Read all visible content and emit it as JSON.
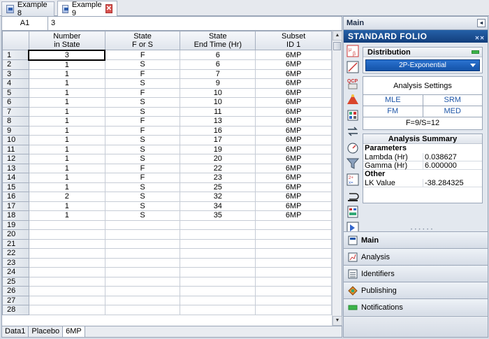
{
  "tabs": [
    {
      "label": "Example 8",
      "active": false
    },
    {
      "label": "Example 9",
      "active": true
    }
  ],
  "formula_bar": {
    "cell_ref": "A1",
    "value": "3"
  },
  "grid": {
    "headers": [
      {
        "line1": "Number",
        "line2": "in State"
      },
      {
        "line1": "State",
        "line2": "F or S"
      },
      {
        "line1": "State",
        "line2": "End Time (Hr)"
      },
      {
        "line1": "Subset",
        "line2": "ID 1"
      }
    ],
    "rows": [
      [
        "3",
        "F",
        "6",
        "6MP"
      ],
      [
        "1",
        "S",
        "6",
        "6MP"
      ],
      [
        "1",
        "F",
        "7",
        "6MP"
      ],
      [
        "1",
        "S",
        "9",
        "6MP"
      ],
      [
        "1",
        "F",
        "10",
        "6MP"
      ],
      [
        "1",
        "S",
        "10",
        "6MP"
      ],
      [
        "1",
        "S",
        "11",
        "6MP"
      ],
      [
        "1",
        "F",
        "13",
        "6MP"
      ],
      [
        "1",
        "F",
        "16",
        "6MP"
      ],
      [
        "1",
        "S",
        "17",
        "6MP"
      ],
      [
        "1",
        "S",
        "19",
        "6MP"
      ],
      [
        "1",
        "S",
        "20",
        "6MP"
      ],
      [
        "1",
        "F",
        "22",
        "6MP"
      ],
      [
        "1",
        "F",
        "23",
        "6MP"
      ],
      [
        "1",
        "S",
        "25",
        "6MP"
      ],
      [
        "2",
        "S",
        "32",
        "6MP"
      ],
      [
        "1",
        "S",
        "34",
        "6MP"
      ],
      [
        "1",
        "S",
        "35",
        "6MP"
      ]
    ],
    "total_rows": 28
  },
  "sheet_tabs": [
    {
      "label": "Data1",
      "active": false
    },
    {
      "label": "Placebo",
      "active": false
    },
    {
      "label": "6MP",
      "active": true
    }
  ],
  "panel": {
    "title": "Main",
    "folio_title": "STANDARD FOLIO",
    "distribution_label": "Distribution",
    "distribution_value": "2P-Exponential",
    "analysis_settings": "Analysis Settings",
    "mle": "MLE",
    "srm": "SRM",
    "fm": "FM",
    "med": "MED",
    "fs_count": "F=9/S=12",
    "summary_title": "Analysis Summary",
    "parameters_label": "Parameters",
    "lambda_label": "Lambda (Hr)",
    "lambda_value": "0.038627",
    "gamma_label": "Gamma (Hr)",
    "gamma_value": "6.000000",
    "other_label": "Other",
    "lk_label": "LK Value",
    "lk_value": "-38.284325"
  },
  "nav": [
    {
      "label": "Main",
      "icon": "main-icon"
    },
    {
      "label": "Analysis",
      "icon": "analysis-icon"
    },
    {
      "label": "Identifiers",
      "icon": "identifiers-icon"
    },
    {
      "label": "Publishing",
      "icon": "publishing-icon"
    },
    {
      "label": "Notifications",
      "icon": "notifications-icon"
    }
  ],
  "colors": {
    "accent": "#1453a8",
    "folio_header": "#123e7c",
    "ok_green": "#3cb54a"
  }
}
